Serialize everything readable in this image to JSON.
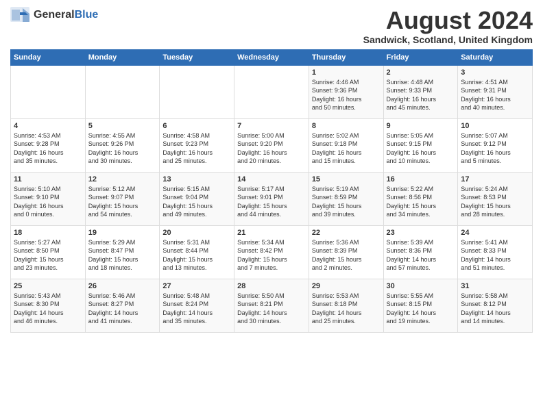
{
  "logo": {
    "general": "General",
    "blue": "Blue"
  },
  "title": "August 2024",
  "subtitle": "Sandwick, Scotland, United Kingdom",
  "days_of_week": [
    "Sunday",
    "Monday",
    "Tuesday",
    "Wednesday",
    "Thursday",
    "Friday",
    "Saturday"
  ],
  "weeks": [
    [
      {
        "day": "",
        "info": ""
      },
      {
        "day": "",
        "info": ""
      },
      {
        "day": "",
        "info": ""
      },
      {
        "day": "",
        "info": ""
      },
      {
        "day": "1",
        "info": "Sunrise: 4:46 AM\nSunset: 9:36 PM\nDaylight: 16 hours\nand 50 minutes."
      },
      {
        "day": "2",
        "info": "Sunrise: 4:48 AM\nSunset: 9:33 PM\nDaylight: 16 hours\nand 45 minutes."
      },
      {
        "day": "3",
        "info": "Sunrise: 4:51 AM\nSunset: 9:31 PM\nDaylight: 16 hours\nand 40 minutes."
      }
    ],
    [
      {
        "day": "4",
        "info": "Sunrise: 4:53 AM\nSunset: 9:28 PM\nDaylight: 16 hours\nand 35 minutes."
      },
      {
        "day": "5",
        "info": "Sunrise: 4:55 AM\nSunset: 9:26 PM\nDaylight: 16 hours\nand 30 minutes."
      },
      {
        "day": "6",
        "info": "Sunrise: 4:58 AM\nSunset: 9:23 PM\nDaylight: 16 hours\nand 25 minutes."
      },
      {
        "day": "7",
        "info": "Sunrise: 5:00 AM\nSunset: 9:20 PM\nDaylight: 16 hours\nand 20 minutes."
      },
      {
        "day": "8",
        "info": "Sunrise: 5:02 AM\nSunset: 9:18 PM\nDaylight: 16 hours\nand 15 minutes."
      },
      {
        "day": "9",
        "info": "Sunrise: 5:05 AM\nSunset: 9:15 PM\nDaylight: 16 hours\nand 10 minutes."
      },
      {
        "day": "10",
        "info": "Sunrise: 5:07 AM\nSunset: 9:12 PM\nDaylight: 16 hours\nand 5 minutes."
      }
    ],
    [
      {
        "day": "11",
        "info": "Sunrise: 5:10 AM\nSunset: 9:10 PM\nDaylight: 16 hours\nand 0 minutes."
      },
      {
        "day": "12",
        "info": "Sunrise: 5:12 AM\nSunset: 9:07 PM\nDaylight: 15 hours\nand 54 minutes."
      },
      {
        "day": "13",
        "info": "Sunrise: 5:15 AM\nSunset: 9:04 PM\nDaylight: 15 hours\nand 49 minutes."
      },
      {
        "day": "14",
        "info": "Sunrise: 5:17 AM\nSunset: 9:01 PM\nDaylight: 15 hours\nand 44 minutes."
      },
      {
        "day": "15",
        "info": "Sunrise: 5:19 AM\nSunset: 8:59 PM\nDaylight: 15 hours\nand 39 minutes."
      },
      {
        "day": "16",
        "info": "Sunrise: 5:22 AM\nSunset: 8:56 PM\nDaylight: 15 hours\nand 34 minutes."
      },
      {
        "day": "17",
        "info": "Sunrise: 5:24 AM\nSunset: 8:53 PM\nDaylight: 15 hours\nand 28 minutes."
      }
    ],
    [
      {
        "day": "18",
        "info": "Sunrise: 5:27 AM\nSunset: 8:50 PM\nDaylight: 15 hours\nand 23 minutes."
      },
      {
        "day": "19",
        "info": "Sunrise: 5:29 AM\nSunset: 8:47 PM\nDaylight: 15 hours\nand 18 minutes."
      },
      {
        "day": "20",
        "info": "Sunrise: 5:31 AM\nSunset: 8:44 PM\nDaylight: 15 hours\nand 13 minutes."
      },
      {
        "day": "21",
        "info": "Sunrise: 5:34 AM\nSunset: 8:42 PM\nDaylight: 15 hours\nand 7 minutes."
      },
      {
        "day": "22",
        "info": "Sunrise: 5:36 AM\nSunset: 8:39 PM\nDaylight: 15 hours\nand 2 minutes."
      },
      {
        "day": "23",
        "info": "Sunrise: 5:39 AM\nSunset: 8:36 PM\nDaylight: 14 hours\nand 57 minutes."
      },
      {
        "day": "24",
        "info": "Sunrise: 5:41 AM\nSunset: 8:33 PM\nDaylight: 14 hours\nand 51 minutes."
      }
    ],
    [
      {
        "day": "25",
        "info": "Sunrise: 5:43 AM\nSunset: 8:30 PM\nDaylight: 14 hours\nand 46 minutes."
      },
      {
        "day": "26",
        "info": "Sunrise: 5:46 AM\nSunset: 8:27 PM\nDaylight: 14 hours\nand 41 minutes."
      },
      {
        "day": "27",
        "info": "Sunrise: 5:48 AM\nSunset: 8:24 PM\nDaylight: 14 hours\nand 35 minutes."
      },
      {
        "day": "28",
        "info": "Sunrise: 5:50 AM\nSunset: 8:21 PM\nDaylight: 14 hours\nand 30 minutes."
      },
      {
        "day": "29",
        "info": "Sunrise: 5:53 AM\nSunset: 8:18 PM\nDaylight: 14 hours\nand 25 minutes."
      },
      {
        "day": "30",
        "info": "Sunrise: 5:55 AM\nSunset: 8:15 PM\nDaylight: 14 hours\nand 19 minutes."
      },
      {
        "day": "31",
        "info": "Sunrise: 5:58 AM\nSunset: 8:12 PM\nDaylight: 14 hours\nand 14 minutes."
      }
    ]
  ]
}
